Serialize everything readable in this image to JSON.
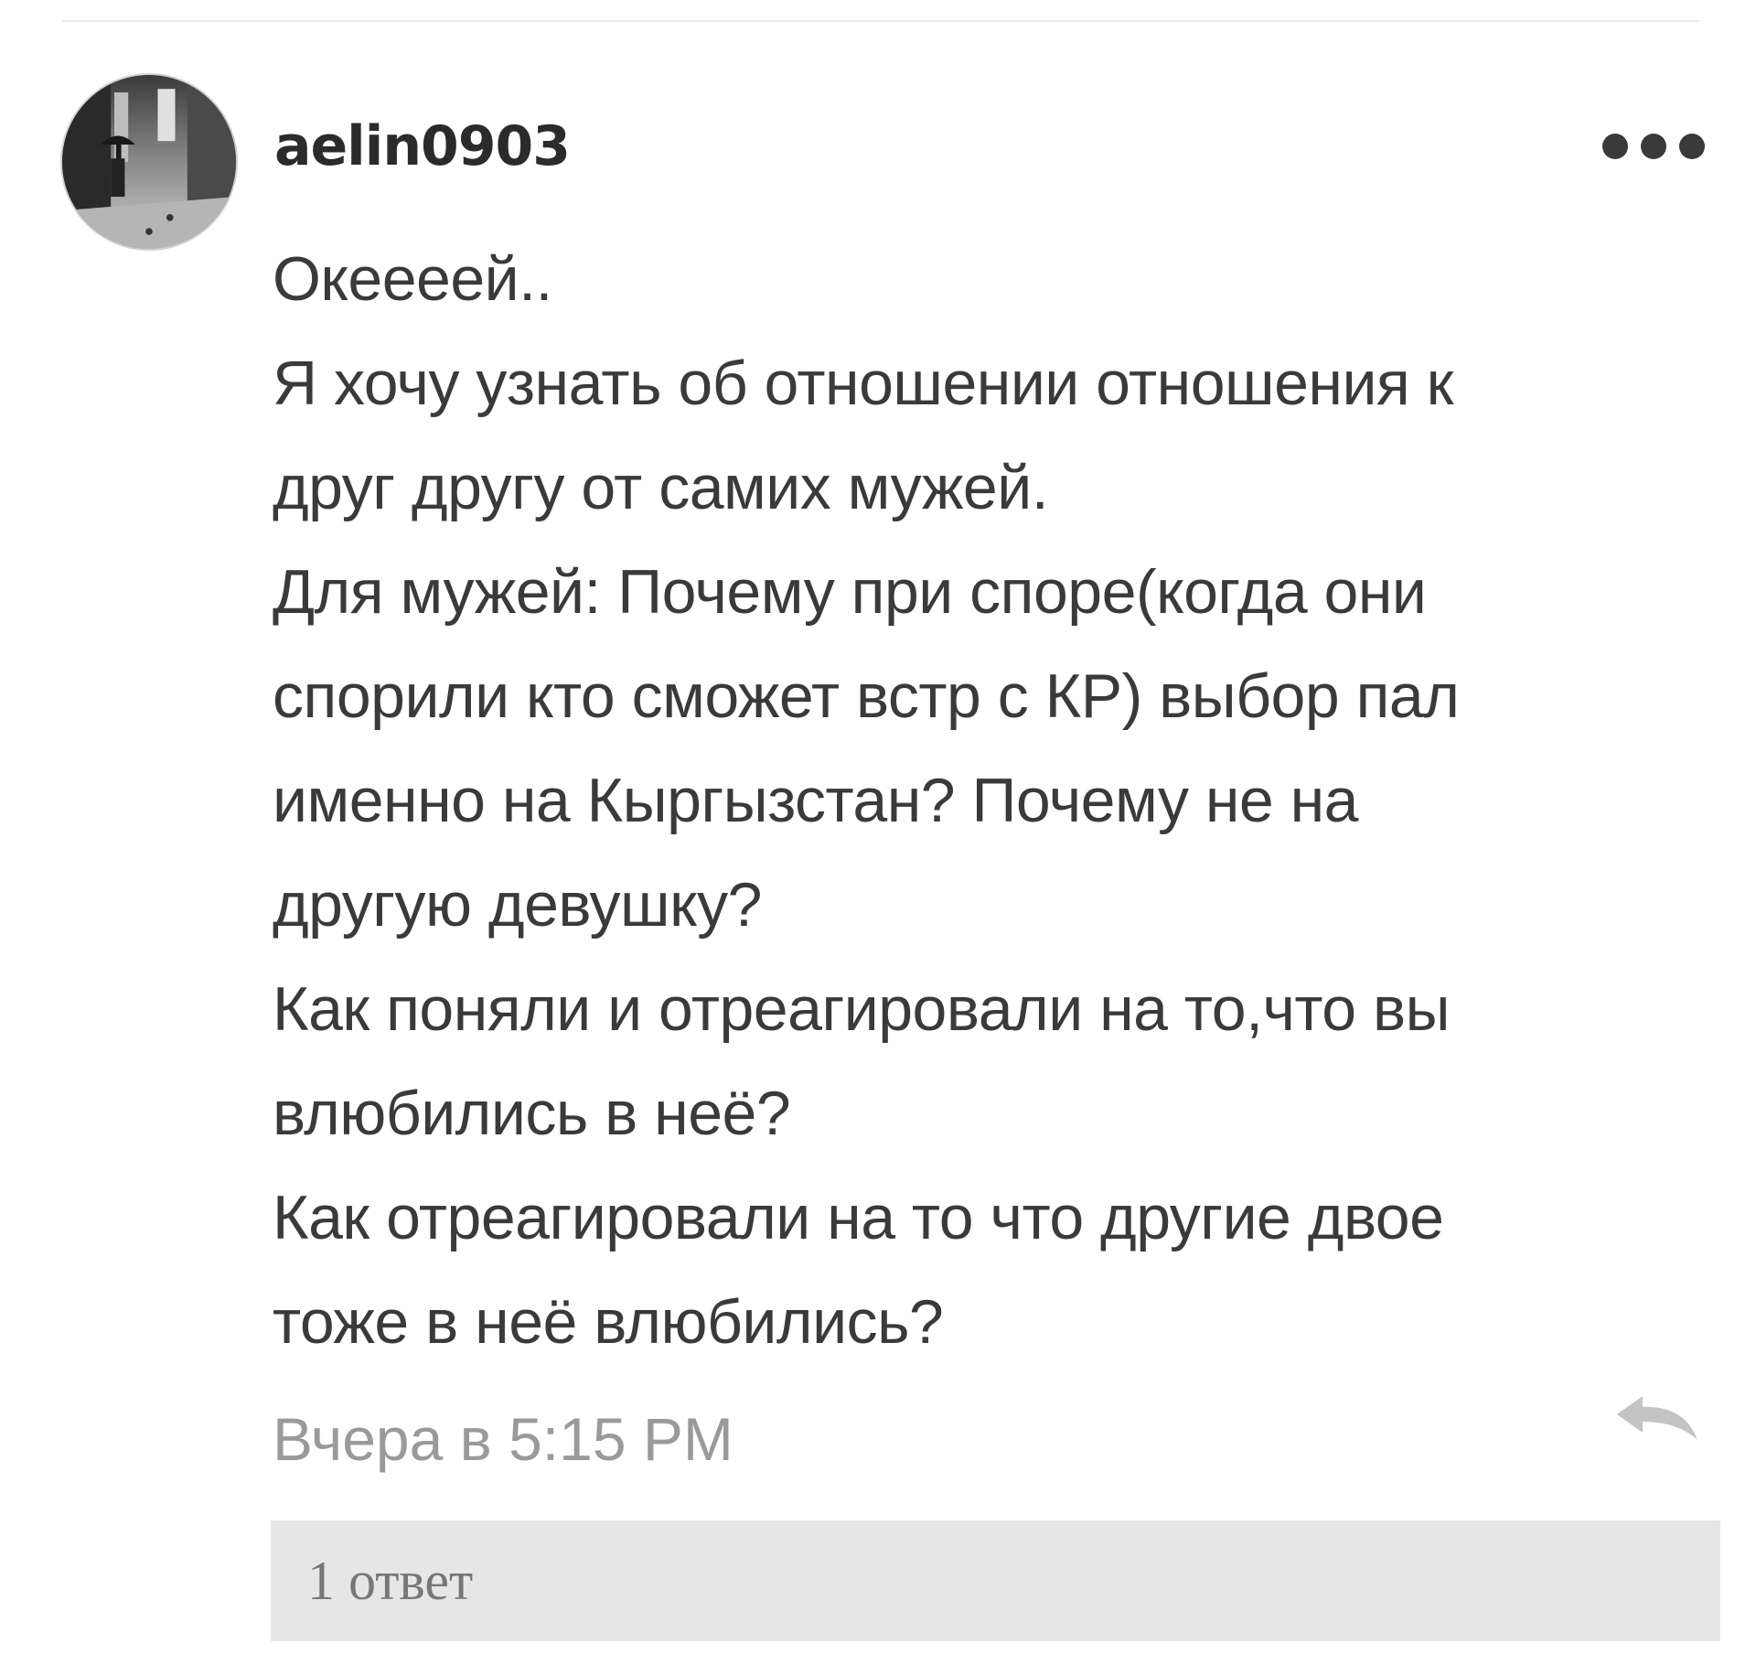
{
  "comment": {
    "username": "aelin0903",
    "avatar_icon": "user-avatar-photo",
    "more_icon": "more-dots-icon",
    "body": "Океееей..\nЯ хочу узнать об отношении отношения к\nдруг другу от самих мужей.\nДля мужей: Почему при споре(когда они\nспорили кто сможет встр с КР) выбор пал\nименно на Кыргызстан? Почему не на\nдругую девушку?\nКак поняли и отреагировали на то,что вы\nвлюбились в неё?\nКак отреагировали на то что другие двое\nтоже в неё влюбились?",
    "timestamp": "Вчера в 5:15 PM",
    "reply_icon": "reply-arrow-icon",
    "replies_label": "1 ответ"
  },
  "colors": {
    "text": "#3a3a3a",
    "muted": "#9a9a9a",
    "replies_bg": "#e6e6e6"
  }
}
